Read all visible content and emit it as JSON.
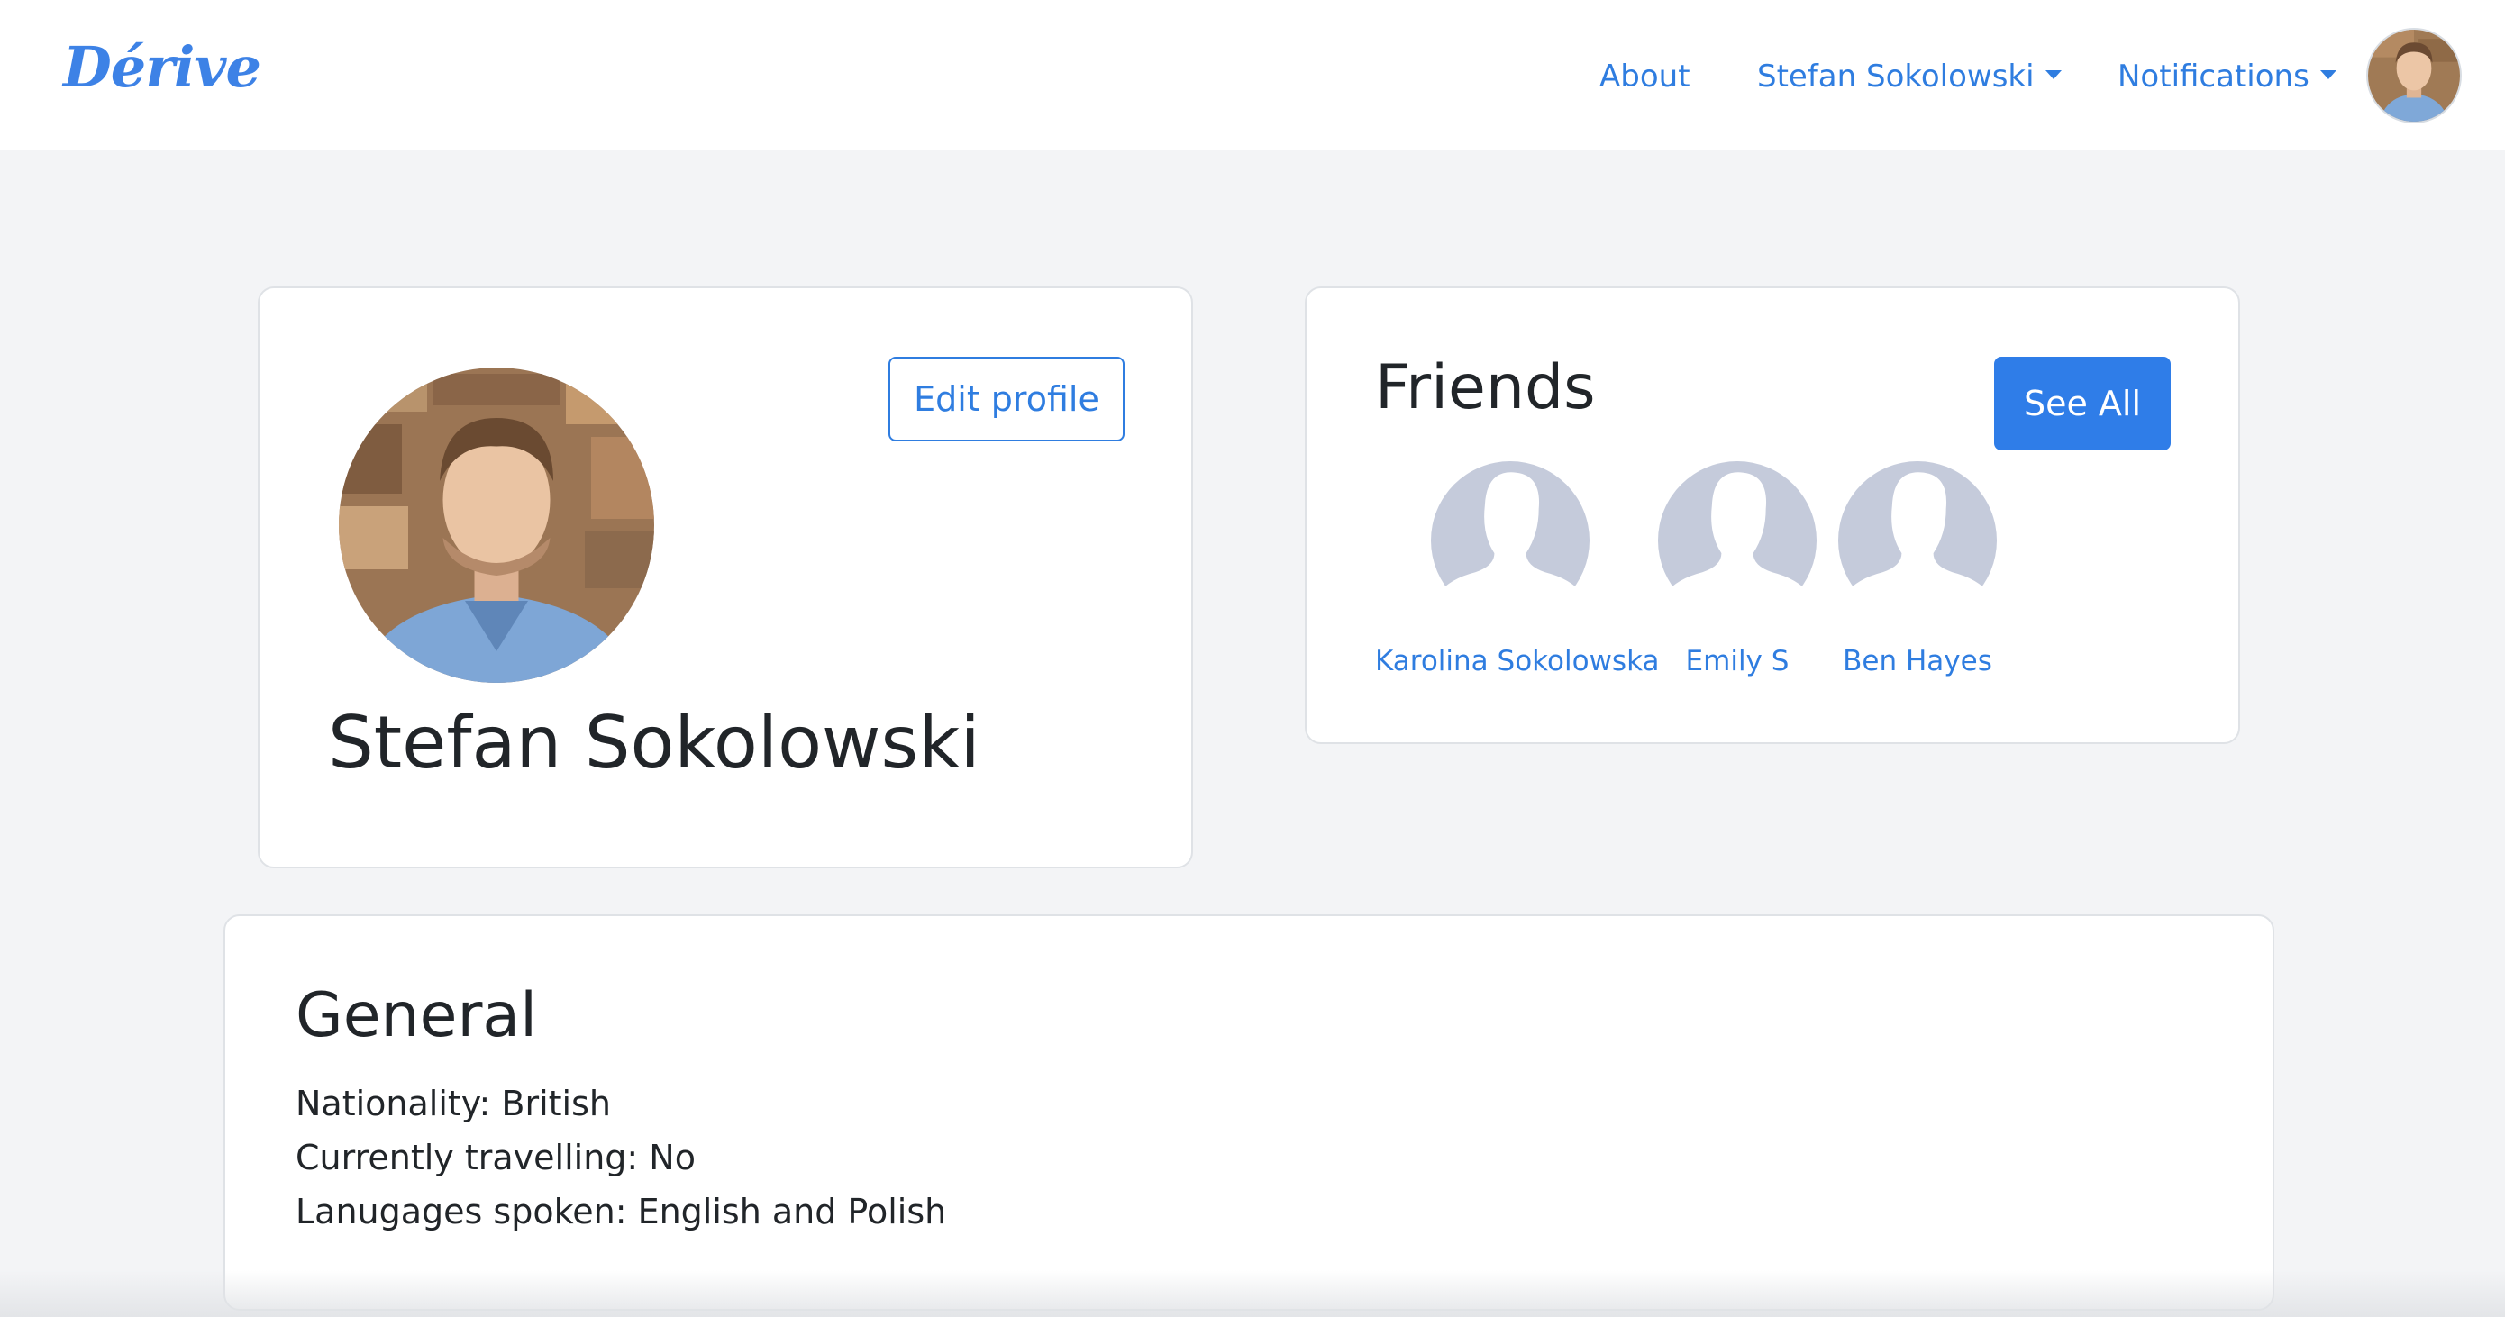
{
  "navbar": {
    "brand": "Dérive",
    "links": {
      "about": "About",
      "user_menu": "Stefan Sokolowski",
      "notifications": "Notifications"
    }
  },
  "profile": {
    "name": "Stefan Sokolowski",
    "edit_button": "Edit profile"
  },
  "friends": {
    "title": "Friends",
    "see_all_button": "See All",
    "list": [
      {
        "name": "Karolina Sokolowska"
      },
      {
        "name": "Emily S"
      },
      {
        "name": "Ben Hayes"
      }
    ]
  },
  "general": {
    "title": "General",
    "lines": [
      "Nationality: British",
      "Currently travelling: No",
      "Lanugages spoken: English and Polish"
    ]
  },
  "colors": {
    "accent": "#2f7de0",
    "button_primary": "#2f7de8",
    "page_background": "#f3f4f6",
    "placeholder_avatar": "#c5cbdb"
  }
}
